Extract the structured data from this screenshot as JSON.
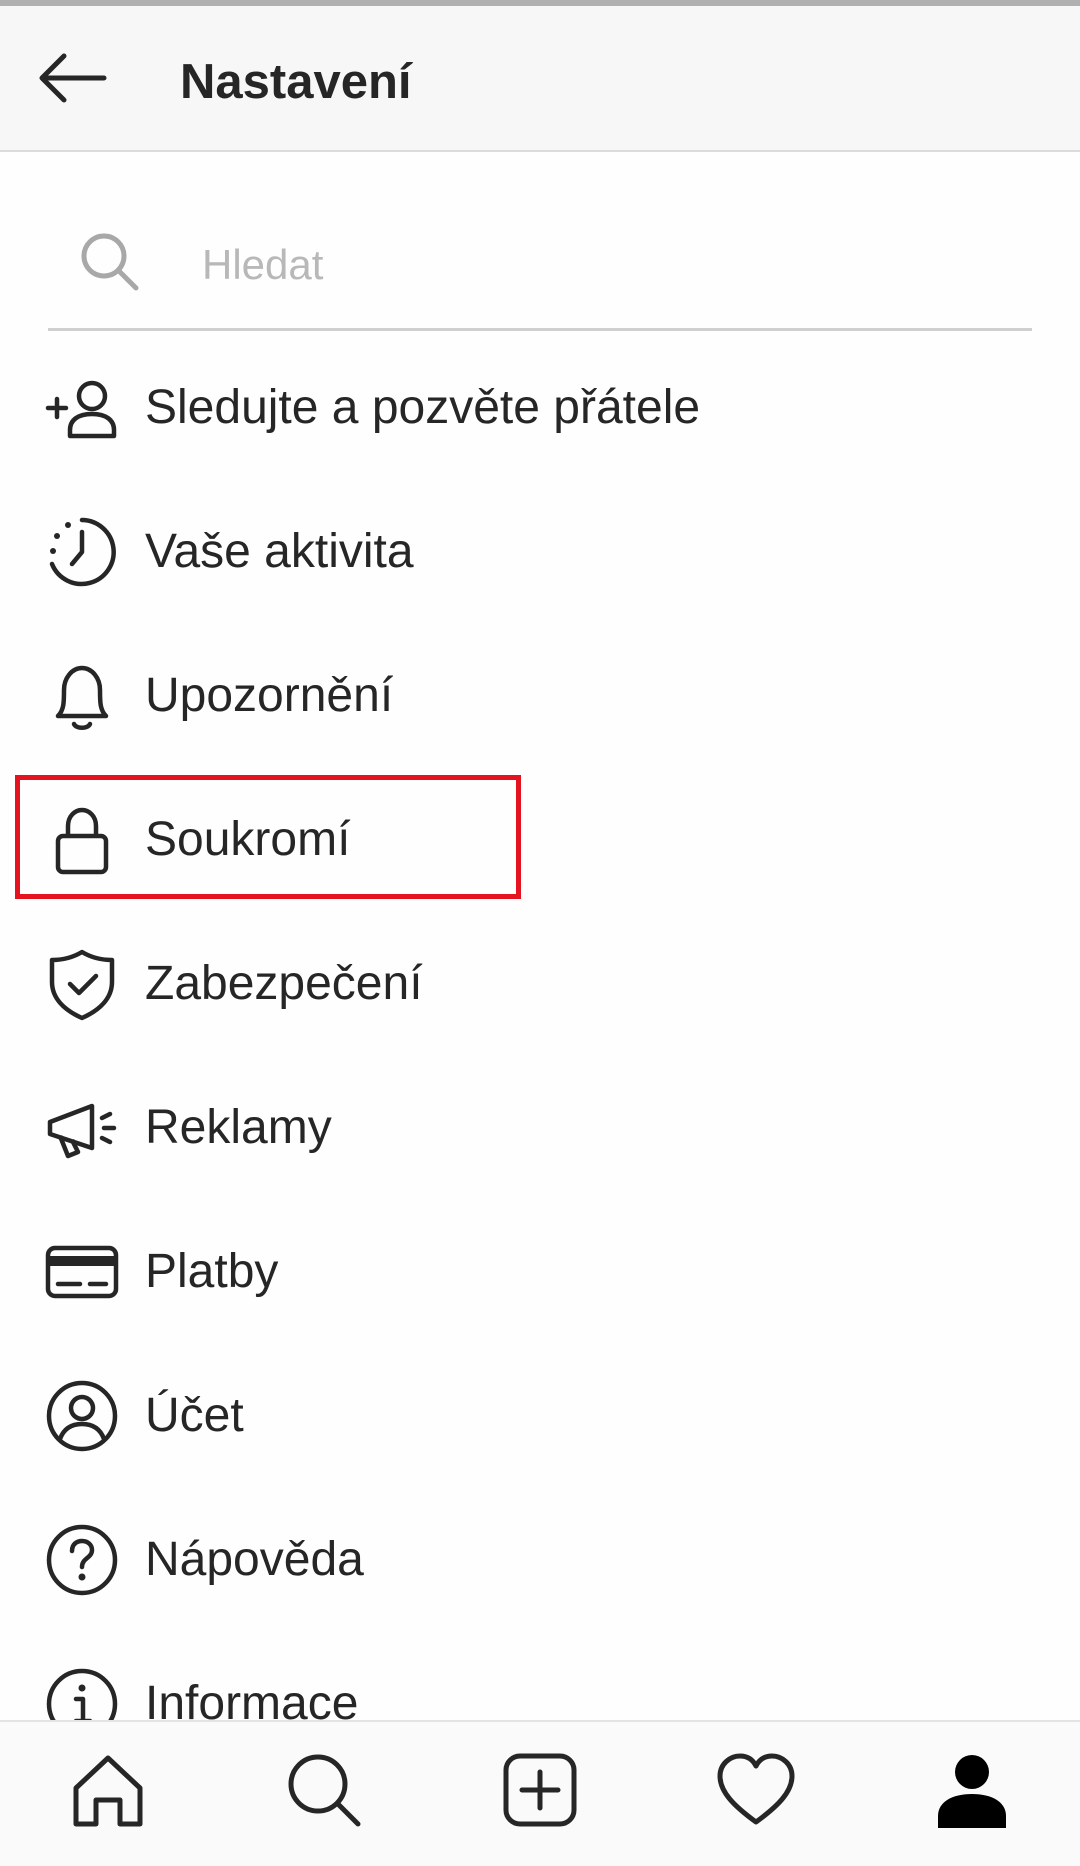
{
  "header": {
    "title": "Nastavení"
  },
  "search": {
    "placeholder": "Hledat"
  },
  "menu": {
    "items": [
      {
        "label": "Sledujte a pozvěte přátele",
        "icon": "add-person-icon"
      },
      {
        "label": "Vaše aktivita",
        "icon": "activity-clock-icon"
      },
      {
        "label": "Upozornění",
        "icon": "bell-icon"
      },
      {
        "label": "Soukromí",
        "icon": "lock-icon"
      },
      {
        "label": "Zabezpečení",
        "icon": "shield-check-icon"
      },
      {
        "label": "Reklamy",
        "icon": "megaphone-icon"
      },
      {
        "label": "Platby",
        "icon": "credit-card-icon"
      },
      {
        "label": "Účet",
        "icon": "account-circle-icon"
      },
      {
        "label": "Nápověda",
        "icon": "help-icon"
      },
      {
        "label": "Informace",
        "icon": "info-icon"
      }
    ]
  },
  "bottom_nav": {
    "items": [
      "home-icon",
      "search-icon",
      "new-post-icon",
      "activity-heart-icon",
      "profile-icon"
    ]
  },
  "colors": {
    "text": "#262626",
    "highlight_border": "#e5131f",
    "placeholder": "#b8b8b8",
    "header_bg": "#f7f7f7"
  }
}
